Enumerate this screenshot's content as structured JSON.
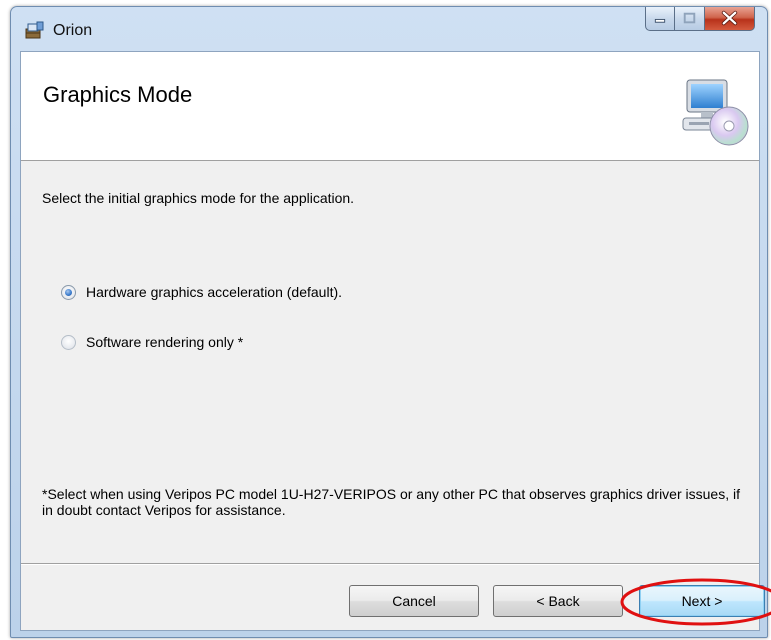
{
  "window": {
    "title": "Orion",
    "app_icon": "installer-package-icon",
    "caption_buttons": [
      "minimize",
      "maximize",
      "close"
    ]
  },
  "banner": {
    "title": "Graphics Mode",
    "icon": "computer-with-cd-icon"
  },
  "body": {
    "instruction": "Select the initial graphics mode for the application.",
    "options": [
      {
        "label": "Hardware graphics acceleration (default).",
        "selected": true
      },
      {
        "label": "Software rendering only *",
        "selected": false
      }
    ],
    "note": "*Select when using Veripos PC model 1U-H27-VERIPOS or any other PC that observes graphics driver issues, if in doubt contact Veripos for assistance."
  },
  "buttons": {
    "cancel": "Cancel",
    "back": "< Back",
    "next": "Next >"
  },
  "colors": {
    "highlight_ring": "#e01010",
    "default_button_border": "#3c7fb1"
  }
}
